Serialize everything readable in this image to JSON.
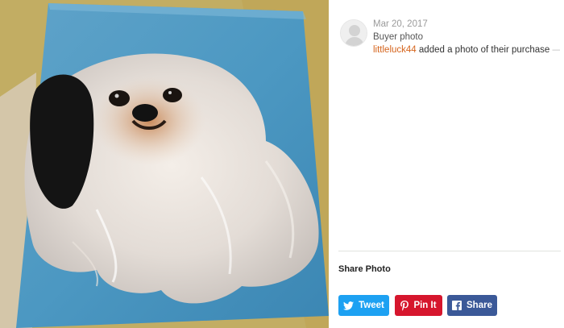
{
  "review": {
    "date": "Mar 20, 2017",
    "kind": "Buyer photo",
    "username": "littleluck44",
    "activity": "added a photo of their purchase",
    "truncation": "—"
  },
  "share": {
    "title": "Share Photo",
    "buttons": [
      {
        "label": "Tweet",
        "icon": "twitter-icon",
        "color": "#1da1f2"
      },
      {
        "label": "Pin It",
        "icon": "pinterest-icon",
        "color": "#d6162d"
      },
      {
        "label": "Share",
        "icon": "facebook-icon",
        "color": "#3b5998"
      }
    ]
  },
  "colors": {
    "accent": "#d5641c",
    "muted": "#9a9a9a",
    "divider": "#e1e3df"
  }
}
